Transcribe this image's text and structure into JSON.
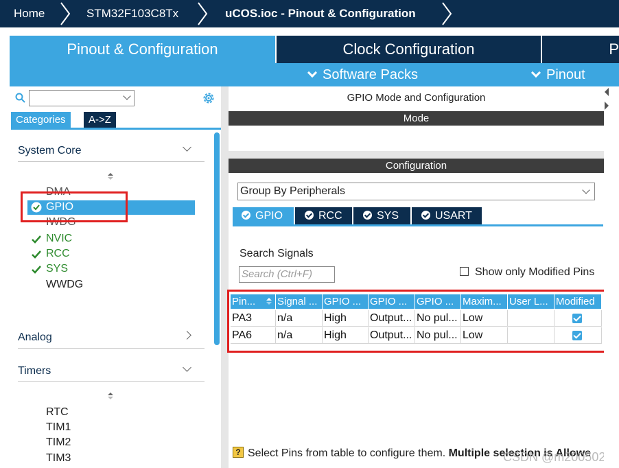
{
  "breadcrumb": {
    "items": [
      "Home",
      "STM32F103C8Tx",
      "uCOS.ioc - Pinout & Configuration"
    ]
  },
  "main_tabs": [
    {
      "label": "Pinout & Configuration",
      "active": true
    },
    {
      "label": "Clock Configuration",
      "active": false
    },
    {
      "label": "P",
      "active": false
    }
  ],
  "sub_tabs": [
    "Software Packs",
    "Pinout"
  ],
  "left": {
    "search_value": "",
    "tabs": [
      "Categories",
      "A->Z"
    ],
    "categories": [
      {
        "name": "System Core",
        "expanded": true,
        "items": [
          {
            "label": "DMA",
            "checked": false,
            "selected": false
          },
          {
            "label": "GPIO",
            "checked": true,
            "selected": true
          },
          {
            "label": "IWDG",
            "checked": false,
            "selected": false
          },
          {
            "label": "NVIC",
            "checked": true,
            "selected": false
          },
          {
            "label": "RCC",
            "checked": true,
            "selected": false
          },
          {
            "label": "SYS",
            "checked": true,
            "selected": false
          },
          {
            "label": "WWDG",
            "checked": false,
            "selected": false
          }
        ]
      },
      {
        "name": "Analog",
        "expanded": false,
        "items": []
      },
      {
        "name": "Timers",
        "expanded": true,
        "items": [
          {
            "label": "RTC"
          },
          {
            "label": "TIM1"
          },
          {
            "label": "TIM2"
          },
          {
            "label": "TIM3"
          }
        ]
      }
    ]
  },
  "right": {
    "title": "GPIO Mode and Configuration",
    "mode_header": "Mode",
    "config_header": "Configuration",
    "group_by": "Group By Peripherals",
    "peripheral_tabs": [
      {
        "label": "GPIO",
        "active": true
      },
      {
        "label": "RCC",
        "active": false
      },
      {
        "label": "SYS",
        "active": false
      },
      {
        "label": "USART",
        "active": false
      }
    ],
    "search_signals_label": "Search Signals",
    "search_placeholder": "Search (Ctrl+F)",
    "show_modified_label": "Show only Modified Pins",
    "table": {
      "headers": [
        "Pin...",
        "Signal ...",
        "GPIO ...",
        "GPIO ...",
        "GPIO ...",
        "Maxim...",
        "User L...",
        "Modified"
      ],
      "rows": [
        [
          "PA3",
          "n/a",
          "High",
          "Output...",
          "No pul...",
          "Low",
          "",
          true
        ],
        [
          "PA6",
          "n/a",
          "High",
          "Output...",
          "No pul...",
          "Low",
          "",
          true
        ]
      ]
    },
    "hint_prefix": "Select Pins from table to configure them.",
    "hint_bold": "Multiple selection is Allowe",
    "watermark": "CSDN @m20050212"
  },
  "colors": {
    "navy": "#0c2d4e",
    "accent": "#3ca6e0",
    "green": "#2e8b2e",
    "highlight_red": "#e02020",
    "dark_bar": "#3d3d3d"
  }
}
